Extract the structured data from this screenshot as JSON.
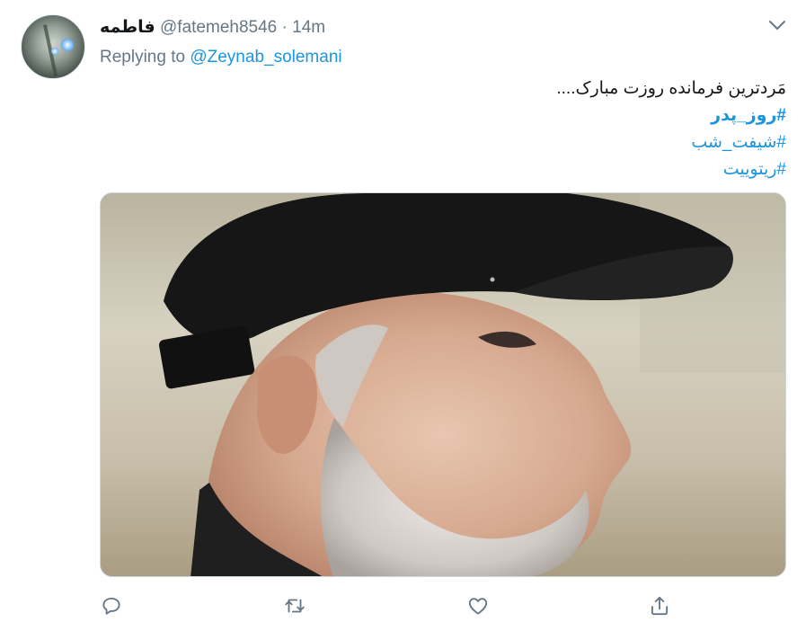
{
  "tweet": {
    "display_name": "فاطمه",
    "handle": "@fatemeh8546",
    "separator": "·",
    "time": "14m",
    "reply_prefix": "Replying to",
    "reply_to": "@Zeynab_solemani",
    "text_line": "مَردترین فرماند‌ه روزت مبارک....",
    "hashtags": [
      "#روز_پدر",
      "#شیفت_شب",
      "#ریتوییت"
    ]
  },
  "media": {
    "description_icon": "photo-icon"
  },
  "actions": [
    {
      "name": "reply",
      "icon": "reply-icon"
    },
    {
      "name": "retweet",
      "icon": "retweet-icon"
    },
    {
      "name": "like",
      "icon": "heart-icon"
    },
    {
      "name": "share",
      "icon": "share-icon"
    }
  ],
  "colors": {
    "link": "#1b95e0",
    "secondary_text": "#657786",
    "primary_text": "#14171a",
    "border": "#ccd6dd"
  }
}
